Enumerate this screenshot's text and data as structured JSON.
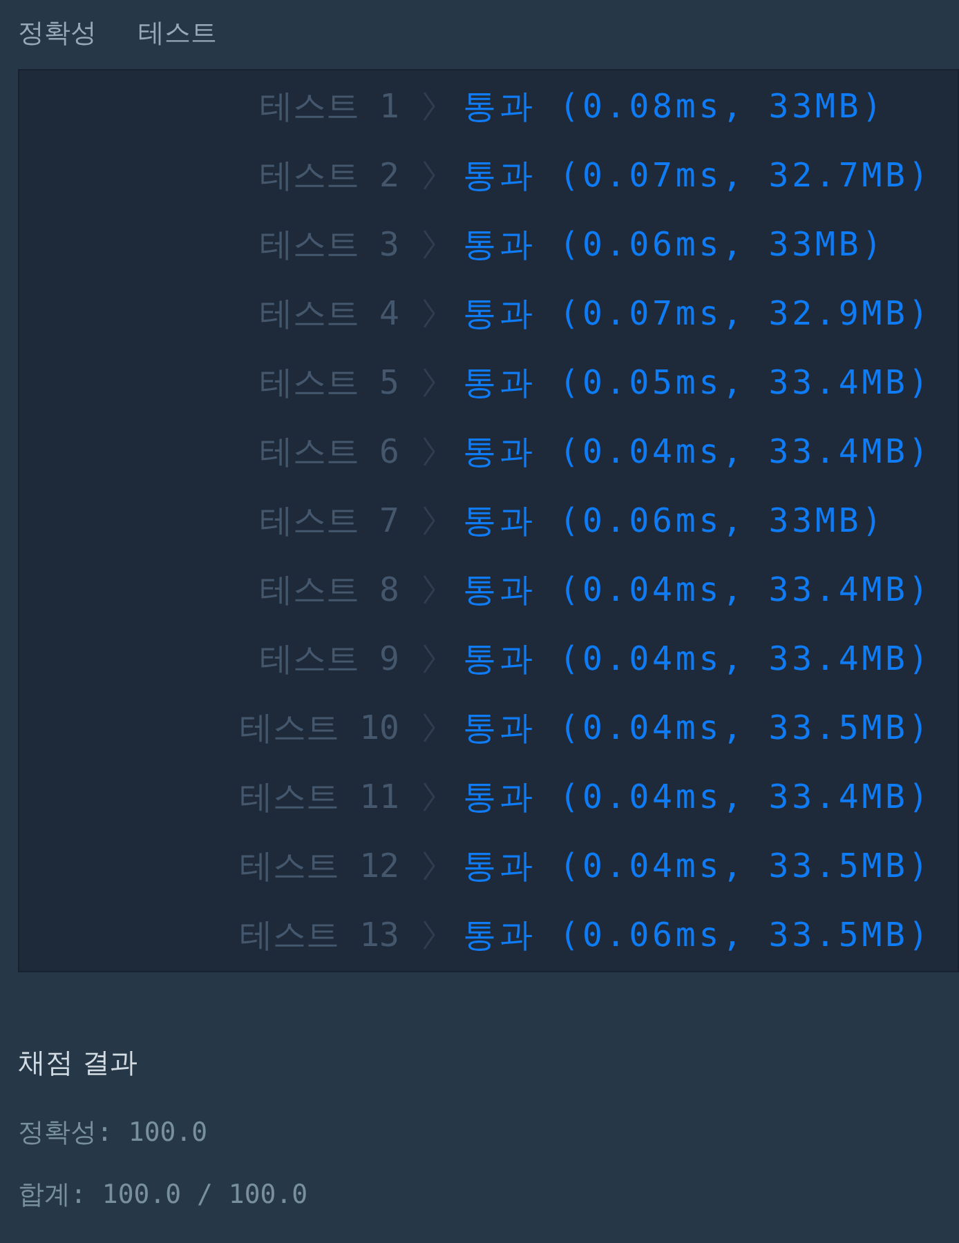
{
  "header": [
    "정확성",
    "테스트"
  ],
  "rows": [
    {
      "label": "테스트 1",
      "result": "통과 (0.08ms, 33MB)"
    },
    {
      "label": "테스트 2",
      "result": "통과 (0.07ms, 32.7MB)"
    },
    {
      "label": "테스트 3",
      "result": "통과 (0.06ms, 33MB)"
    },
    {
      "label": "테스트 4",
      "result": "통과 (0.07ms, 32.9MB)"
    },
    {
      "label": "테스트 5",
      "result": "통과 (0.05ms, 33.4MB)"
    },
    {
      "label": "테스트 6",
      "result": "통과 (0.04ms, 33.4MB)"
    },
    {
      "label": "테스트 7",
      "result": "통과 (0.06ms, 33MB)"
    },
    {
      "label": "테스트 8",
      "result": "통과 (0.04ms, 33.4MB)"
    },
    {
      "label": "테스트 9",
      "result": "통과 (0.04ms, 33.4MB)"
    },
    {
      "label": "테스트 10",
      "result": "통과 (0.04ms, 33.5MB)"
    },
    {
      "label": "테스트 11",
      "result": "통과 (0.04ms, 33.4MB)"
    },
    {
      "label": "테스트 12",
      "result": "통과 (0.04ms, 33.5MB)"
    },
    {
      "label": "테스트 13",
      "result": "통과 (0.06ms, 33.5MB)"
    }
  ],
  "summary": {
    "title": "채점 결과",
    "accuracy": "정확성: 100.0",
    "total": "합계: 100.0 / 100.0"
  }
}
